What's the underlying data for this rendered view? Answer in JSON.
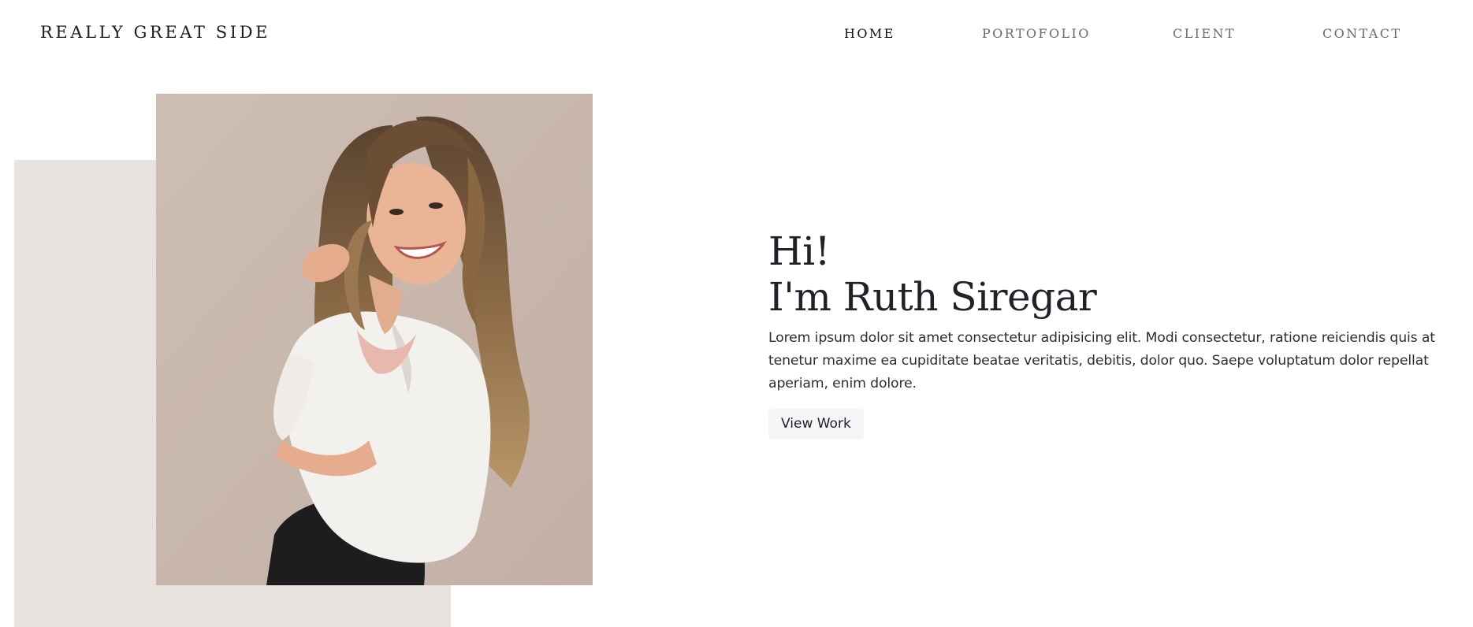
{
  "brand": {
    "name": "REALLY GREAT SIDE"
  },
  "nav": {
    "items": [
      {
        "label": "HOME",
        "active": true
      },
      {
        "label": "PORTOFOLIO",
        "active": false
      },
      {
        "label": "CLIENT",
        "active": false
      },
      {
        "label": "CONTACT",
        "active": false
      }
    ]
  },
  "hero": {
    "greeting_line1": "Hi!",
    "greeting_line2": "I'm Ruth Siregar",
    "intro": "Lorem ipsum dolor sit amet consectetur adipisicing elit. Modi consectetur, ratione reiciendis quis at tenetur maxime ea cupiditate beatae veritatis, debitis, dolor quo. Saepe voluptatum dolor repellat aperiam, enim dolore.",
    "cta_label": "View Work"
  },
  "colors": {
    "backdrop": "#e8e3df",
    "photo_background": "#c9b8ae",
    "button_background": "#f5f6f8"
  }
}
